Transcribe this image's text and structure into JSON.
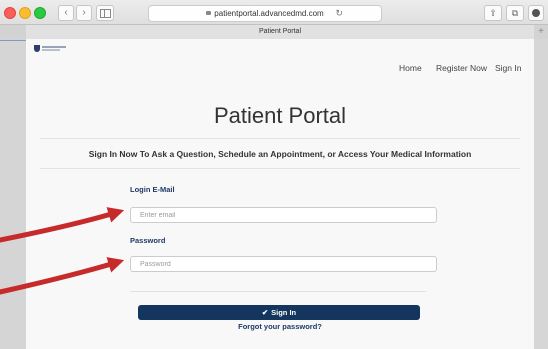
{
  "browser": {
    "url": "patientportal.advancedmd.com",
    "tab_title": "Patient Portal",
    "back_glyph": "‹",
    "forward_glyph": "›",
    "reload_glyph": "↻",
    "share_glyph": "⇪",
    "tabs_glyph": "⧉",
    "new_tab_glyph": "+"
  },
  "nav": {
    "home": "Home",
    "register": "Register Now",
    "signin": "Sign In"
  },
  "page": {
    "title": "Patient Portal",
    "subtitle": "Sign In Now To Ask a Question, Schedule an Appointment, or Access Your Medical Information"
  },
  "form": {
    "email_label": "Login E-Mail",
    "email_placeholder": "Enter email",
    "email_value": "",
    "password_label": "Password",
    "password_placeholder": "Password",
    "password_value": "",
    "signin_label": "Sign In",
    "signin_glyph": "✔",
    "forgot_label": "Forgot your password?"
  },
  "colors": {
    "primary": "#13355e",
    "label": "#1f3a66",
    "arrow": "#c62a2a"
  }
}
